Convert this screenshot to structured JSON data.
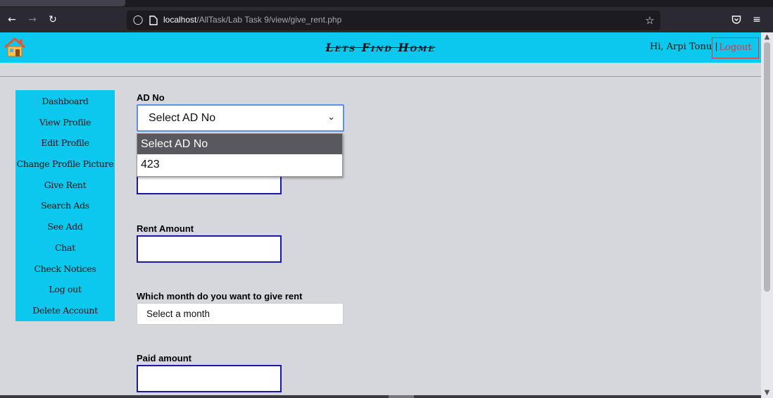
{
  "browser": {
    "back_icon": "arrow-left-icon",
    "forward_icon": "arrow-right-icon",
    "reload_icon": "reload-icon",
    "url_host": "localhost",
    "url_path": "/AllTask/Lab Task 9/view/give_rent.php",
    "pocket_icon": "pocket-icon",
    "menu_icon": "hamburger-menu-icon",
    "bookmark_icon": "star-icon"
  },
  "header": {
    "title": "Lets Find Home",
    "greeting": "Hi, Arpi Tonu |",
    "logout_label": "Logout",
    "logo_icon": "house-icon"
  },
  "sidebar": {
    "items": [
      {
        "label": "Dashboard"
      },
      {
        "label": "View Profile"
      },
      {
        "label": "Edit Profile"
      },
      {
        "label": "Change Profile Picture"
      },
      {
        "label": "Give Rent"
      },
      {
        "label": "Search Ads"
      },
      {
        "label": "See Add"
      },
      {
        "label": "Chat"
      },
      {
        "label": "Check Notices"
      },
      {
        "label": "Log out"
      },
      {
        "label": "Delete Account"
      }
    ]
  },
  "form": {
    "ad_no": {
      "label": "AD No",
      "selected": "Select AD No",
      "options": [
        "Select AD No",
        "423"
      ]
    },
    "rent_amount": {
      "label": "Rent Amount",
      "value": ""
    },
    "month": {
      "label": "Which month do you want to give rent",
      "selected": "Select a month"
    },
    "paid_amount": {
      "label": "Paid amount",
      "value": ""
    }
  },
  "colors": {
    "accent": "#0cc8ef",
    "input_border": "#1a1aa6",
    "logout": "#e0343b",
    "page_bg": "#d5d7dc"
  }
}
